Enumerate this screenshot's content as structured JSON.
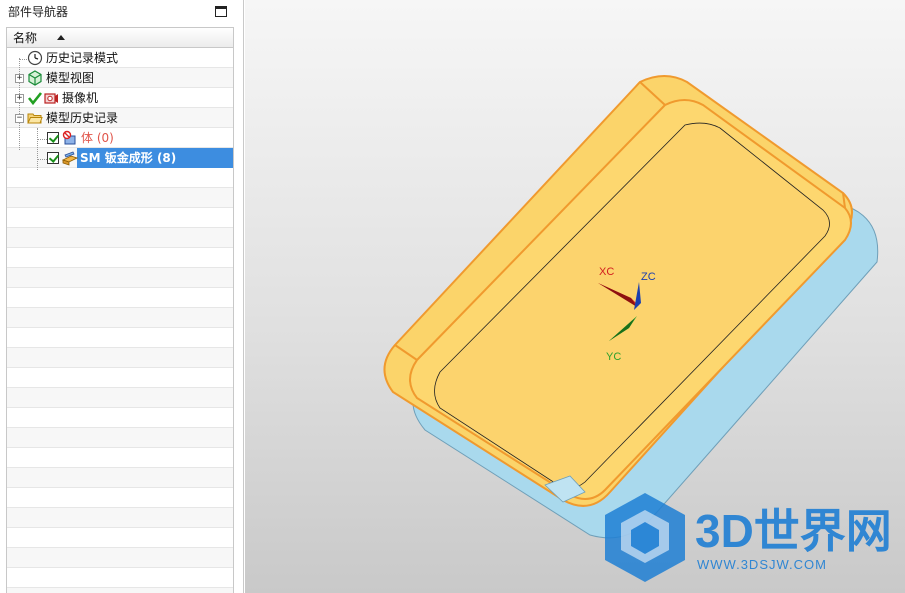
{
  "navigator": {
    "title": "部件导航器",
    "column_header": "名称",
    "items": [
      {
        "label": "历史记录模式"
      },
      {
        "label": "模型视图"
      },
      {
        "label": "摄像机"
      },
      {
        "label": "模型历史记录"
      },
      {
        "label": "体 (0)"
      },
      {
        "label": "SM 钣金成形 (8)"
      }
    ]
  },
  "viewport": {
    "axis_labels": {
      "x": "XC",
      "y": "YC",
      "z": "ZC"
    }
  },
  "watermark": {
    "brand": "3D世界网",
    "url": "WWW.3DSJW.COM"
  },
  "colors": {
    "selection": "#3d8de0",
    "part_face": "#fbd46a",
    "part_edge": "#f09a2e",
    "base_face": "#a7d8ec",
    "axis_x": "#d22020",
    "axis_y": "#2ea02e",
    "axis_z": "#1b3fae",
    "watermark": "#1f7fd4"
  }
}
